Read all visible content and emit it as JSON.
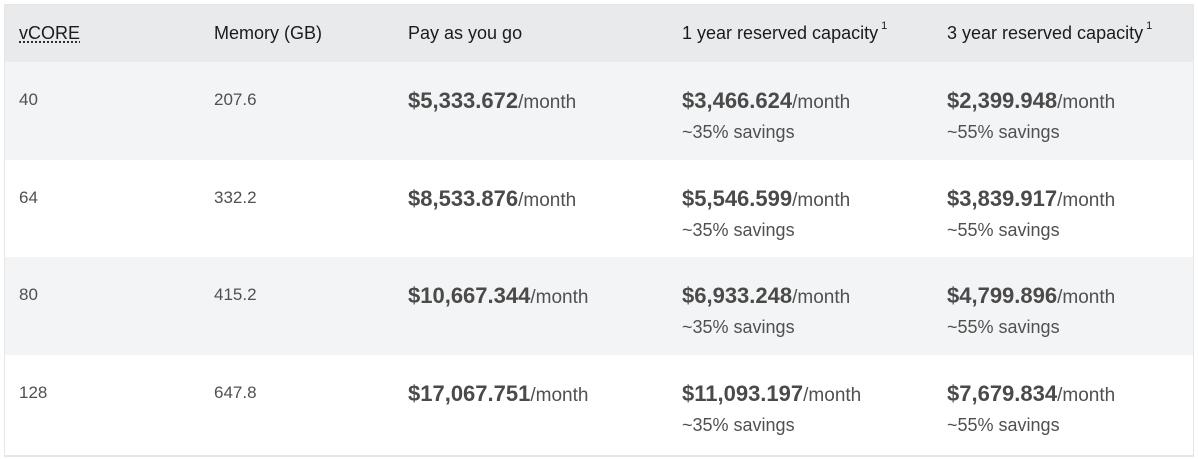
{
  "headers": {
    "vcore": "vCORE",
    "memory": "Memory (GB)",
    "payg": "Pay as you go",
    "one_year": "1 year reserved capacity",
    "one_year_note": "1",
    "three_year": "3 year reserved capacity",
    "three_year_note": "1"
  },
  "unit_suffix": "/month",
  "rows": [
    {
      "vcore": "40",
      "memory": "207.6",
      "payg": "$5,333.672",
      "one_year": "$3,466.624",
      "one_year_savings": "~35% savings",
      "three_year": "$2,399.948",
      "three_year_savings": "~55% savings"
    },
    {
      "vcore": "64",
      "memory": "332.2",
      "payg": "$8,533.876",
      "one_year": "$5,546.599",
      "one_year_savings": "~35% savings",
      "three_year": "$3,839.917",
      "three_year_savings": "~55% savings"
    },
    {
      "vcore": "80",
      "memory": "415.2",
      "payg": "$10,667.344",
      "one_year": "$6,933.248",
      "one_year_savings": "~35% savings",
      "three_year": "$4,799.896",
      "three_year_savings": "~55% savings"
    },
    {
      "vcore": "128",
      "memory": "647.8",
      "payg": "$17,067.751",
      "one_year": "$11,093.197",
      "one_year_savings": "~35% savings",
      "three_year": "$7,679.834",
      "three_year_savings": "~55% savings"
    }
  ]
}
